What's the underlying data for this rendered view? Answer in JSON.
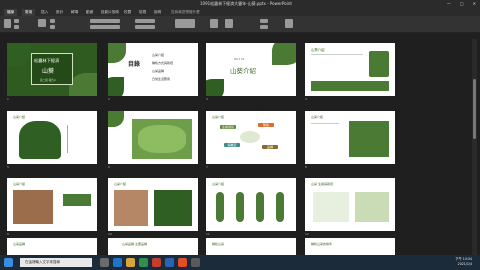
{
  "window": {
    "title": "1091松露林下經濟大豐年-山葵.pptx - PowerPoint"
  },
  "tabs": [
    "檔案",
    "常用",
    "插入",
    "設計",
    "轉場",
    "動畫",
    "投影片放映",
    "校閱",
    "檢視",
    "說明"
  ],
  "ribbon": {
    "search_hint": "告訴我您想做什麼"
  },
  "slides": [
    {
      "num": "1",
      "title": "松露林下經濟",
      "subtitle": "山葵",
      "footer": "第二組 報告人"
    },
    {
      "num": "2",
      "heading": "目錄",
      "items": [
        "山葵介紹",
        "種植方式與栽培",
        "山葵品種",
        "日常生活應用"
      ]
    },
    {
      "num": "3",
      "part": "Part 01",
      "title": "山葵介紹"
    },
    {
      "num": "4",
      "heading": "山葵介紹"
    },
    {
      "num": "5",
      "heading": "山葵介紹"
    },
    {
      "num": "6",
      "heading": ""
    },
    {
      "num": "7",
      "heading": "山葵介紹",
      "tags": [
        "生長環境",
        "繁殖",
        "病蟲害",
        "品種"
      ]
    },
    {
      "num": "8",
      "heading": "山葵介紹"
    },
    {
      "num": "9",
      "heading": "山葵介紹"
    },
    {
      "num": "10",
      "heading": "山葵介紹"
    },
    {
      "num": "11",
      "heading": "山葵介紹"
    },
    {
      "num": "12",
      "heading": "山葵 生長與栽培"
    },
    {
      "num": "13",
      "heading": "山葵品種"
    },
    {
      "num": "14",
      "heading": "山葵品種 主要品種"
    },
    {
      "num": "15",
      "heading": "種植山葵"
    },
    {
      "num": "16",
      "heading": "種植山葵的條件"
    }
  ],
  "taskbar": {
    "search_placeholder": "在這裡輸入文字來搜尋",
    "time": "下午 10:54",
    "date": "2021/1/4"
  }
}
